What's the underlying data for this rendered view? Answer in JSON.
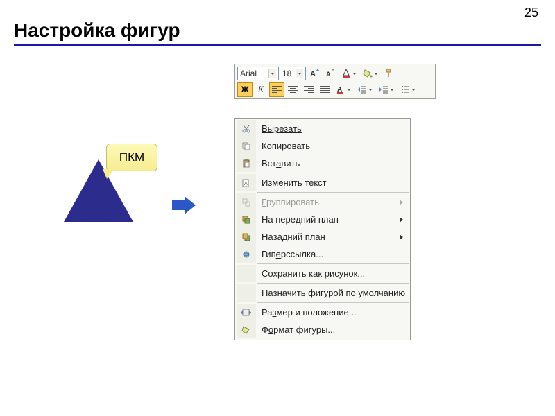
{
  "page": {
    "title": "Настройка фигур",
    "number": "25"
  },
  "callout": {
    "label": "ПКМ"
  },
  "toolbar": {
    "font": "Arial",
    "size": "18",
    "bold": "Ж",
    "italic": "К"
  },
  "menu": {
    "cut": "Вырезать",
    "copy_pre": "К",
    "copy_u": "о",
    "copy_post": "пировать",
    "paste_pre": "Вст",
    "paste_u": "а",
    "paste_post": "вить",
    "edit_text_pre": "Измени",
    "edit_text_u": "т",
    "edit_text_post": "ь текст",
    "group_u": "Г",
    "group_post": "руппировать",
    "front_pre": "На пере",
    "front_u": "д",
    "front_post": "ний план",
    "back_pre": "На ",
    "back_u": "з",
    "back_post": "адний план",
    "hyperlink_pre": "Гип",
    "hyperlink_u": "е",
    "hyperlink_post": "рссылка...",
    "save_pic": "Сохранить как рисунок...",
    "default_pre": "Н",
    "default_u": "а",
    "default_post": "значить фигурой по умолчанию",
    "size_pre": "Ра",
    "size_u": "з",
    "size_post": "мер и положение...",
    "format_pre": "Ф",
    "format_u": "о",
    "format_post": "рмат фигуры..."
  }
}
